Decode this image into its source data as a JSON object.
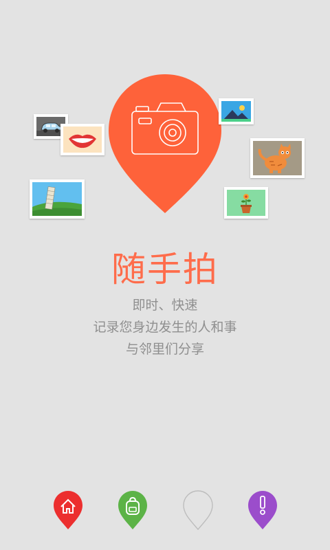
{
  "intro": {
    "title": "随手拍",
    "lines": [
      "即时、快速",
      "记录您身边发生的人和事",
      "与邻里们分享"
    ]
  },
  "colors": {
    "background": "#e3e3e3",
    "accent": "#fe623a",
    "title": "#fe6c4b",
    "text_muted": "#8f8f8f"
  },
  "hero": {
    "icon": "camera-icon"
  },
  "thumbnails": [
    {
      "icon": "car-icon"
    },
    {
      "icon": "lips-icon"
    },
    {
      "icon": "leaning-tower-icon"
    },
    {
      "icon": "landscape-icon"
    },
    {
      "icon": "cat-icon"
    },
    {
      "icon": "flower-pot-icon"
    }
  ],
  "page_indicator": {
    "count": 4,
    "current": 3,
    "pins": [
      {
        "icon": "home-icon",
        "color": "#ec2f2f"
      },
      {
        "icon": "backpack-icon",
        "color": "#5cb347"
      },
      {
        "icon": "empty-pin-icon",
        "color": "#e3e3e3"
      },
      {
        "icon": "exclamation-icon",
        "color": "#9b4dcb"
      }
    ]
  }
}
